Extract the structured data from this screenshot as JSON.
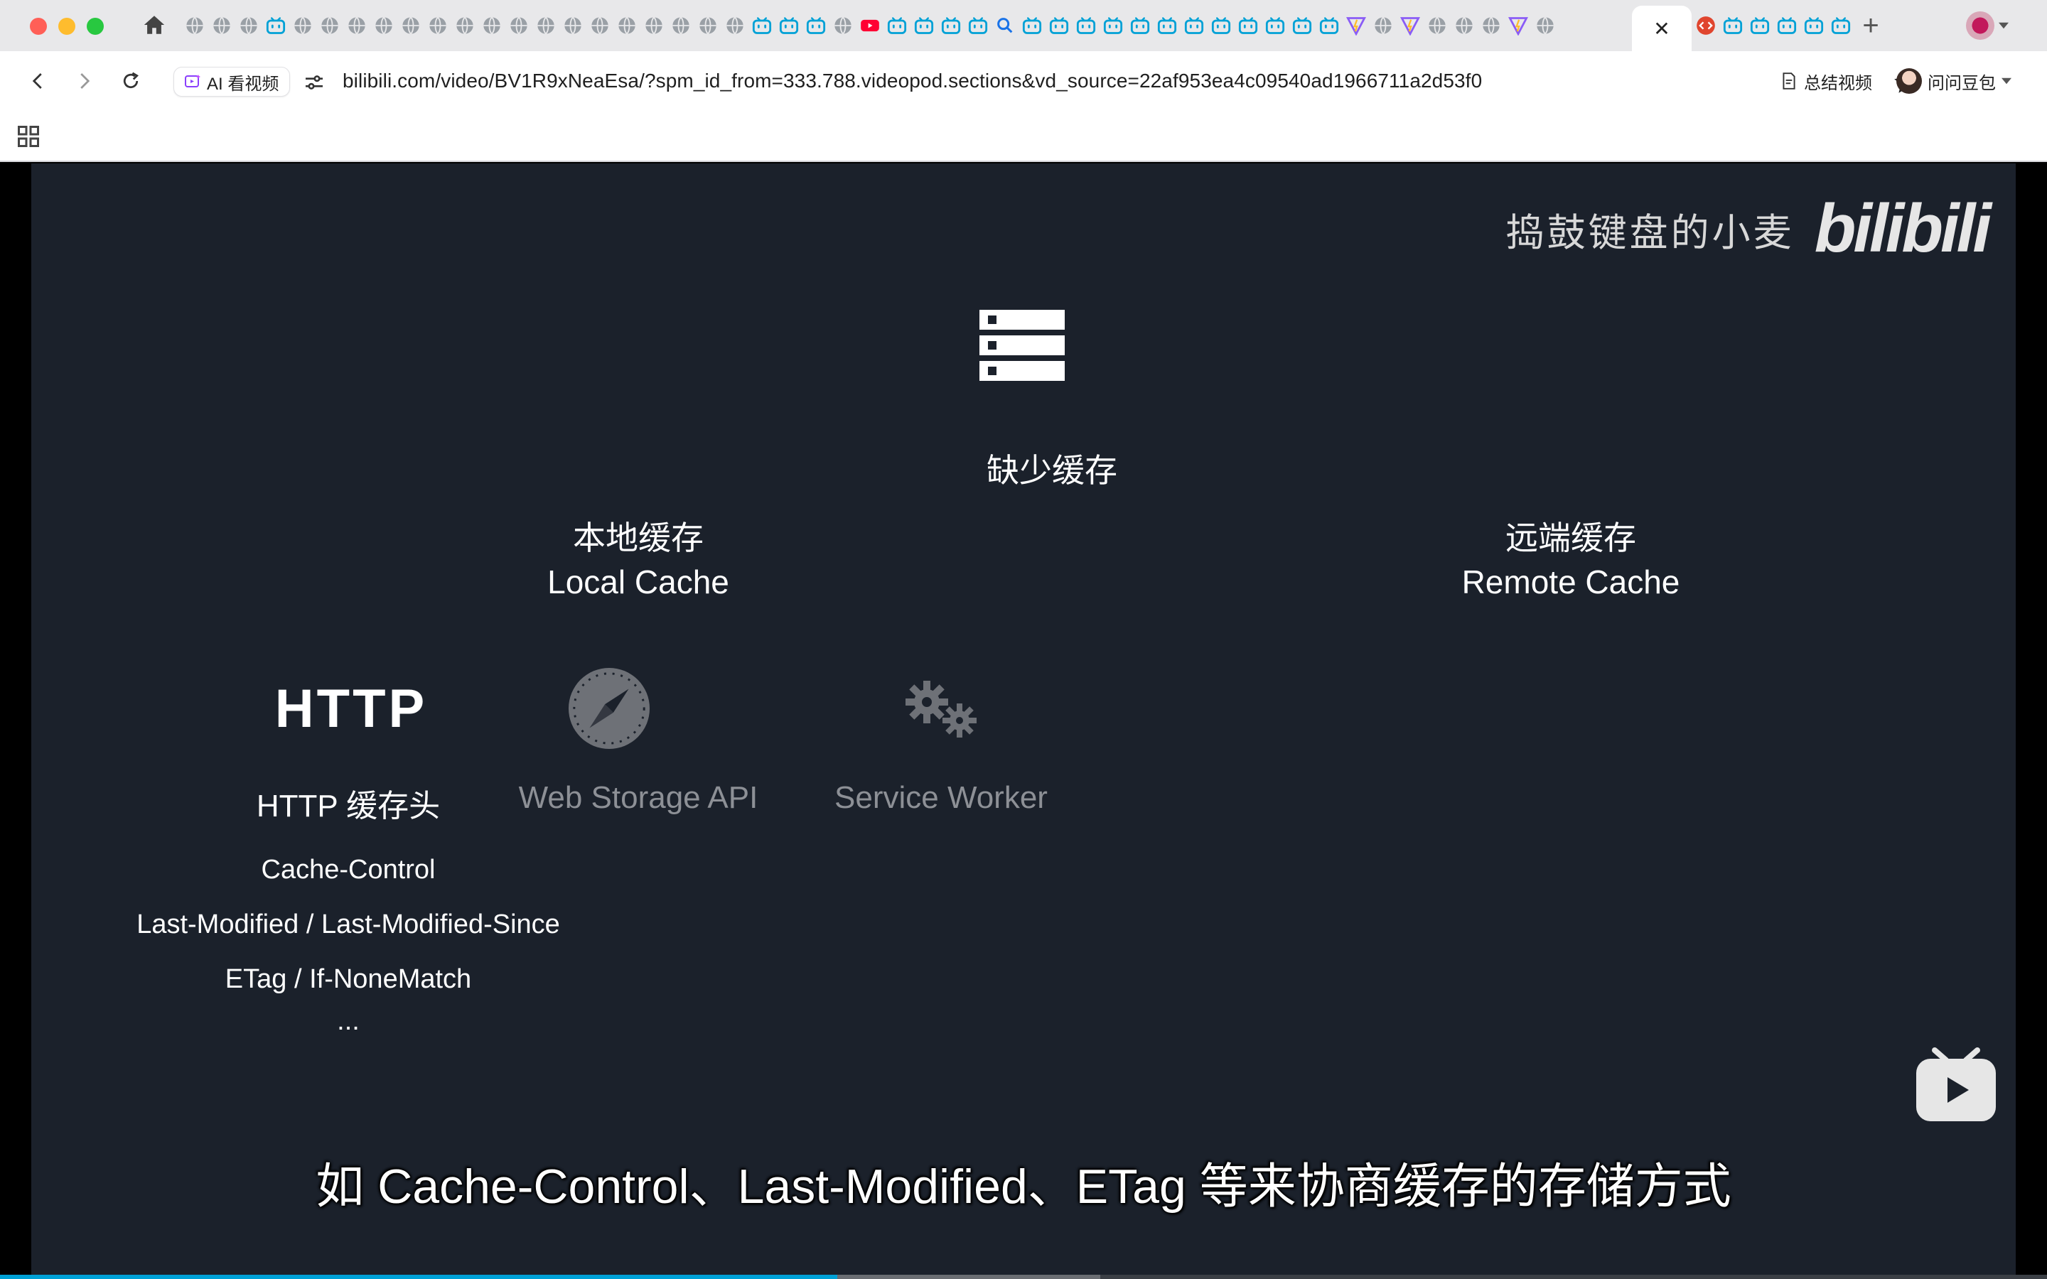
{
  "browser": {
    "tab_close_glyph": "✕",
    "new_tab_glyph": "+",
    "address": {
      "ai_chip_label": "AI 看视频",
      "url": "bilibili.com/video/BV1R9xNeaEsa/?spm_id_from=333.788.videopod.sections&vd_source=22af953ea4c09540ad1966711a2d53f0"
    },
    "toolbar": {
      "summary_label": "总结视频",
      "doubao_label": "问问豆包"
    },
    "tabs_before_active": [
      "globe",
      "globe",
      "globe",
      "bili",
      "globe",
      "globe",
      "globe",
      "globe",
      "globe",
      "globe",
      "globe",
      "globe",
      "globe",
      "globe",
      "globe",
      "globe",
      "globe",
      "globe",
      "globe",
      "globe",
      "globe",
      "bili",
      "bili",
      "bili",
      "globe",
      "youtube",
      "bili",
      "bili",
      "bili",
      "bili",
      "search",
      "bili",
      "bili",
      "bili",
      "bili",
      "bili",
      "bili",
      "bili",
      "bili",
      "bili",
      "bili",
      "bili",
      "bili",
      "vite",
      "globe",
      "vite",
      "globe",
      "globe",
      "globe",
      "vite",
      "globe"
    ],
    "tabs_after_active": [
      "devtools",
      "bili",
      "bili",
      "bili",
      "bili",
      "bili"
    ]
  },
  "video": {
    "watermark_author": "捣鼓键盘的小麦",
    "watermark_brand": "bilibili",
    "heading": "缺少缓存",
    "local": {
      "title_cn": "本地缓存",
      "title_en": "Local Cache"
    },
    "remote": {
      "title_cn": "远端缓存",
      "title_en": "Remote Cache"
    },
    "http_logo": "HTTP",
    "items": {
      "http": "HTTP 缓存头",
      "web_storage": "Web Storage API",
      "service_worker": "Service Worker"
    },
    "http_headers": [
      "Cache-Control",
      "Last-Modified / Last-Modified-Since",
      "ETag / If-NoneMatch",
      "..."
    ],
    "subtitle": "如 Cache-Control、Last-Modified、ETag 等来协商缓存的存储方式",
    "progress": {
      "played_fraction": 0.409,
      "buffered_fraction": 0.5375
    }
  },
  "colors": {
    "video_background": "#1b212b",
    "dimmed_text": "#8d9096",
    "progress_played": "#00a1d6",
    "bili_blue": "#00a1d6"
  }
}
